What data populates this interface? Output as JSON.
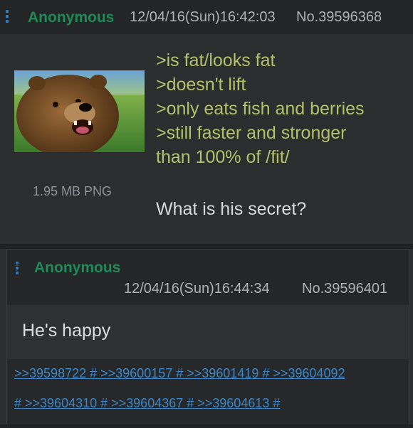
{
  "op": {
    "name": "Anonymous",
    "datetime": "12/04/16(Sun)16:42:03",
    "post_no": "No.39596368",
    "file_info": "1.95 MB PNG",
    "image": "brown-bear-thumbnail",
    "greentext": [
      ">is fat/looks fat",
      ">doesn't lift",
      ">only eats fish and berries",
      ">still faster and stronger",
      "than 100% of /fit/"
    ],
    "message": "What is his secret?"
  },
  "reply": {
    "name": "Anonymous",
    "datetime": "12/04/16(Sun)16:44:34",
    "post_no": "No.39596401",
    "message": "He's happy",
    "backlinks": [
      ">>39598722 # >>39600157 # >>39601419 # >>39604092",
      "# >>39604310 # >>39604367 # >>39604613 #"
    ]
  },
  "colors": {
    "name": "#1f8a5a",
    "greentext": "#b5c06a",
    "link": "#3a87c9",
    "background": "#2b2d2f"
  }
}
